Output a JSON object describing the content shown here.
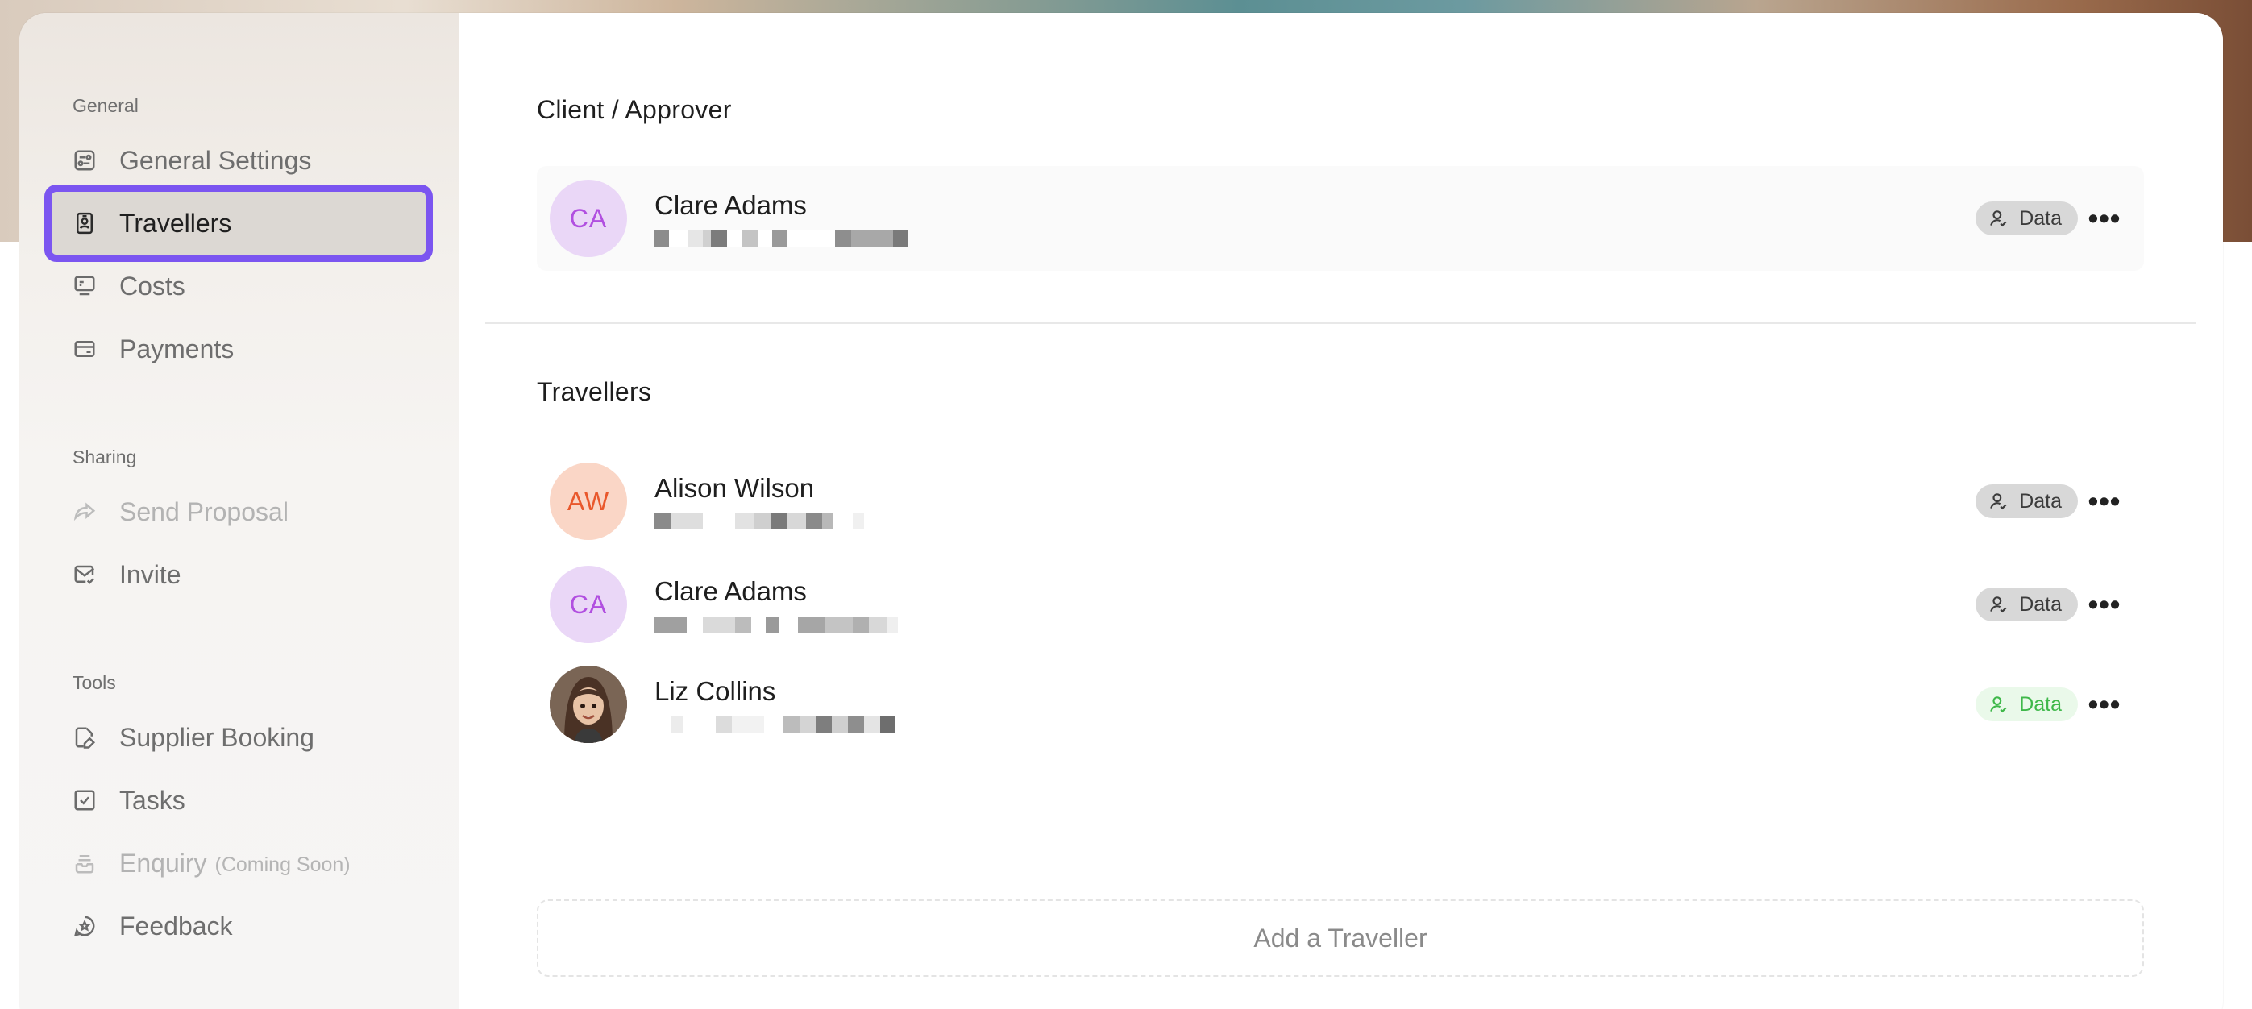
{
  "sidebar": {
    "sections": {
      "general": "General",
      "sharing": "Sharing",
      "tools": "Tools"
    },
    "items": [
      {
        "label": "General Settings",
        "icon": "settings-sliders-icon"
      },
      {
        "label": "Travellers",
        "icon": "traveller-badge-icon",
        "active": true
      },
      {
        "label": "Costs",
        "icon": "costs-icon"
      },
      {
        "label": "Payments",
        "icon": "credit-card-icon"
      },
      {
        "label": "Send Proposal",
        "icon": "share-arrow-icon",
        "disabled": true
      },
      {
        "label": "Invite",
        "icon": "mail-check-icon"
      },
      {
        "label": "Supplier Booking",
        "icon": "edit-document-icon"
      },
      {
        "label": "Tasks",
        "icon": "checkbox-icon"
      },
      {
        "label": "Enquiry",
        "sub": "(Coming Soon)",
        "icon": "inbox-icon",
        "disabled": true
      },
      {
        "label": "Feedback",
        "icon": "star-bubble-icon"
      }
    ]
  },
  "main": {
    "client_section_title": "Client / Approver",
    "client": {
      "initials": "CA",
      "name": "Clare Adams",
      "badge": "Data"
    },
    "travellers_section_title": "Travellers",
    "travellers": [
      {
        "initials": "AW",
        "name": "Alison Wilson",
        "badge": "Data",
        "badge_color": "gray"
      },
      {
        "initials": "CA",
        "name": "Clare Adams",
        "badge": "Data",
        "badge_color": "gray"
      },
      {
        "initials": "",
        "name": "Liz Collins",
        "badge": "Data",
        "badge_color": "green"
      }
    ],
    "add_button": "Add a Traveller"
  },
  "colors": {
    "accent_outline": "#7b55f0",
    "badge_green": "#3fb84a",
    "avatar_purple": "#b14fe0",
    "avatar_orange": "#e9582c"
  }
}
